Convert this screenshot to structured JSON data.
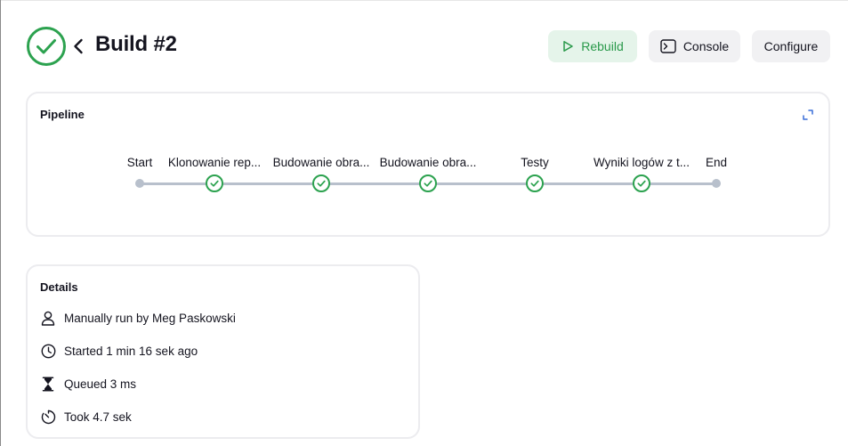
{
  "header": {
    "title": "Build #2",
    "status": "success",
    "back_icon": "chevron-left-icon",
    "buttons": {
      "rebuild": "Rebuild",
      "console": "Console",
      "configure": "Configure"
    }
  },
  "pipeline": {
    "title": "Pipeline",
    "stages": [
      {
        "label": "Start",
        "kind": "terminal"
      },
      {
        "label": "Klonowanie rep...",
        "kind": "stage",
        "status": "success"
      },
      {
        "label": "Budowanie obra...",
        "kind": "stage",
        "status": "success"
      },
      {
        "label": "Budowanie obra...",
        "kind": "stage",
        "status": "success"
      },
      {
        "label": "Testy",
        "kind": "stage",
        "status": "success"
      },
      {
        "label": "Wyniki logów z t...",
        "kind": "stage",
        "status": "success"
      },
      {
        "label": "End",
        "kind": "terminal"
      }
    ]
  },
  "details": {
    "title": "Details",
    "rows": [
      {
        "icon": "user-icon",
        "text": "Manually run by Meg Paskowski"
      },
      {
        "icon": "clock-icon",
        "text": "Started 1 min 16 sek ago"
      },
      {
        "icon": "hourglass-icon",
        "text": "Queued 3 ms"
      },
      {
        "icon": "timer-icon",
        "text": "Took 4.7 sek"
      }
    ]
  },
  "colors": {
    "success": "#2ca24f",
    "rebuild_bg": "#e5f4ea",
    "button_bg": "#f1f1f3",
    "connector": "#b8c0cc"
  }
}
